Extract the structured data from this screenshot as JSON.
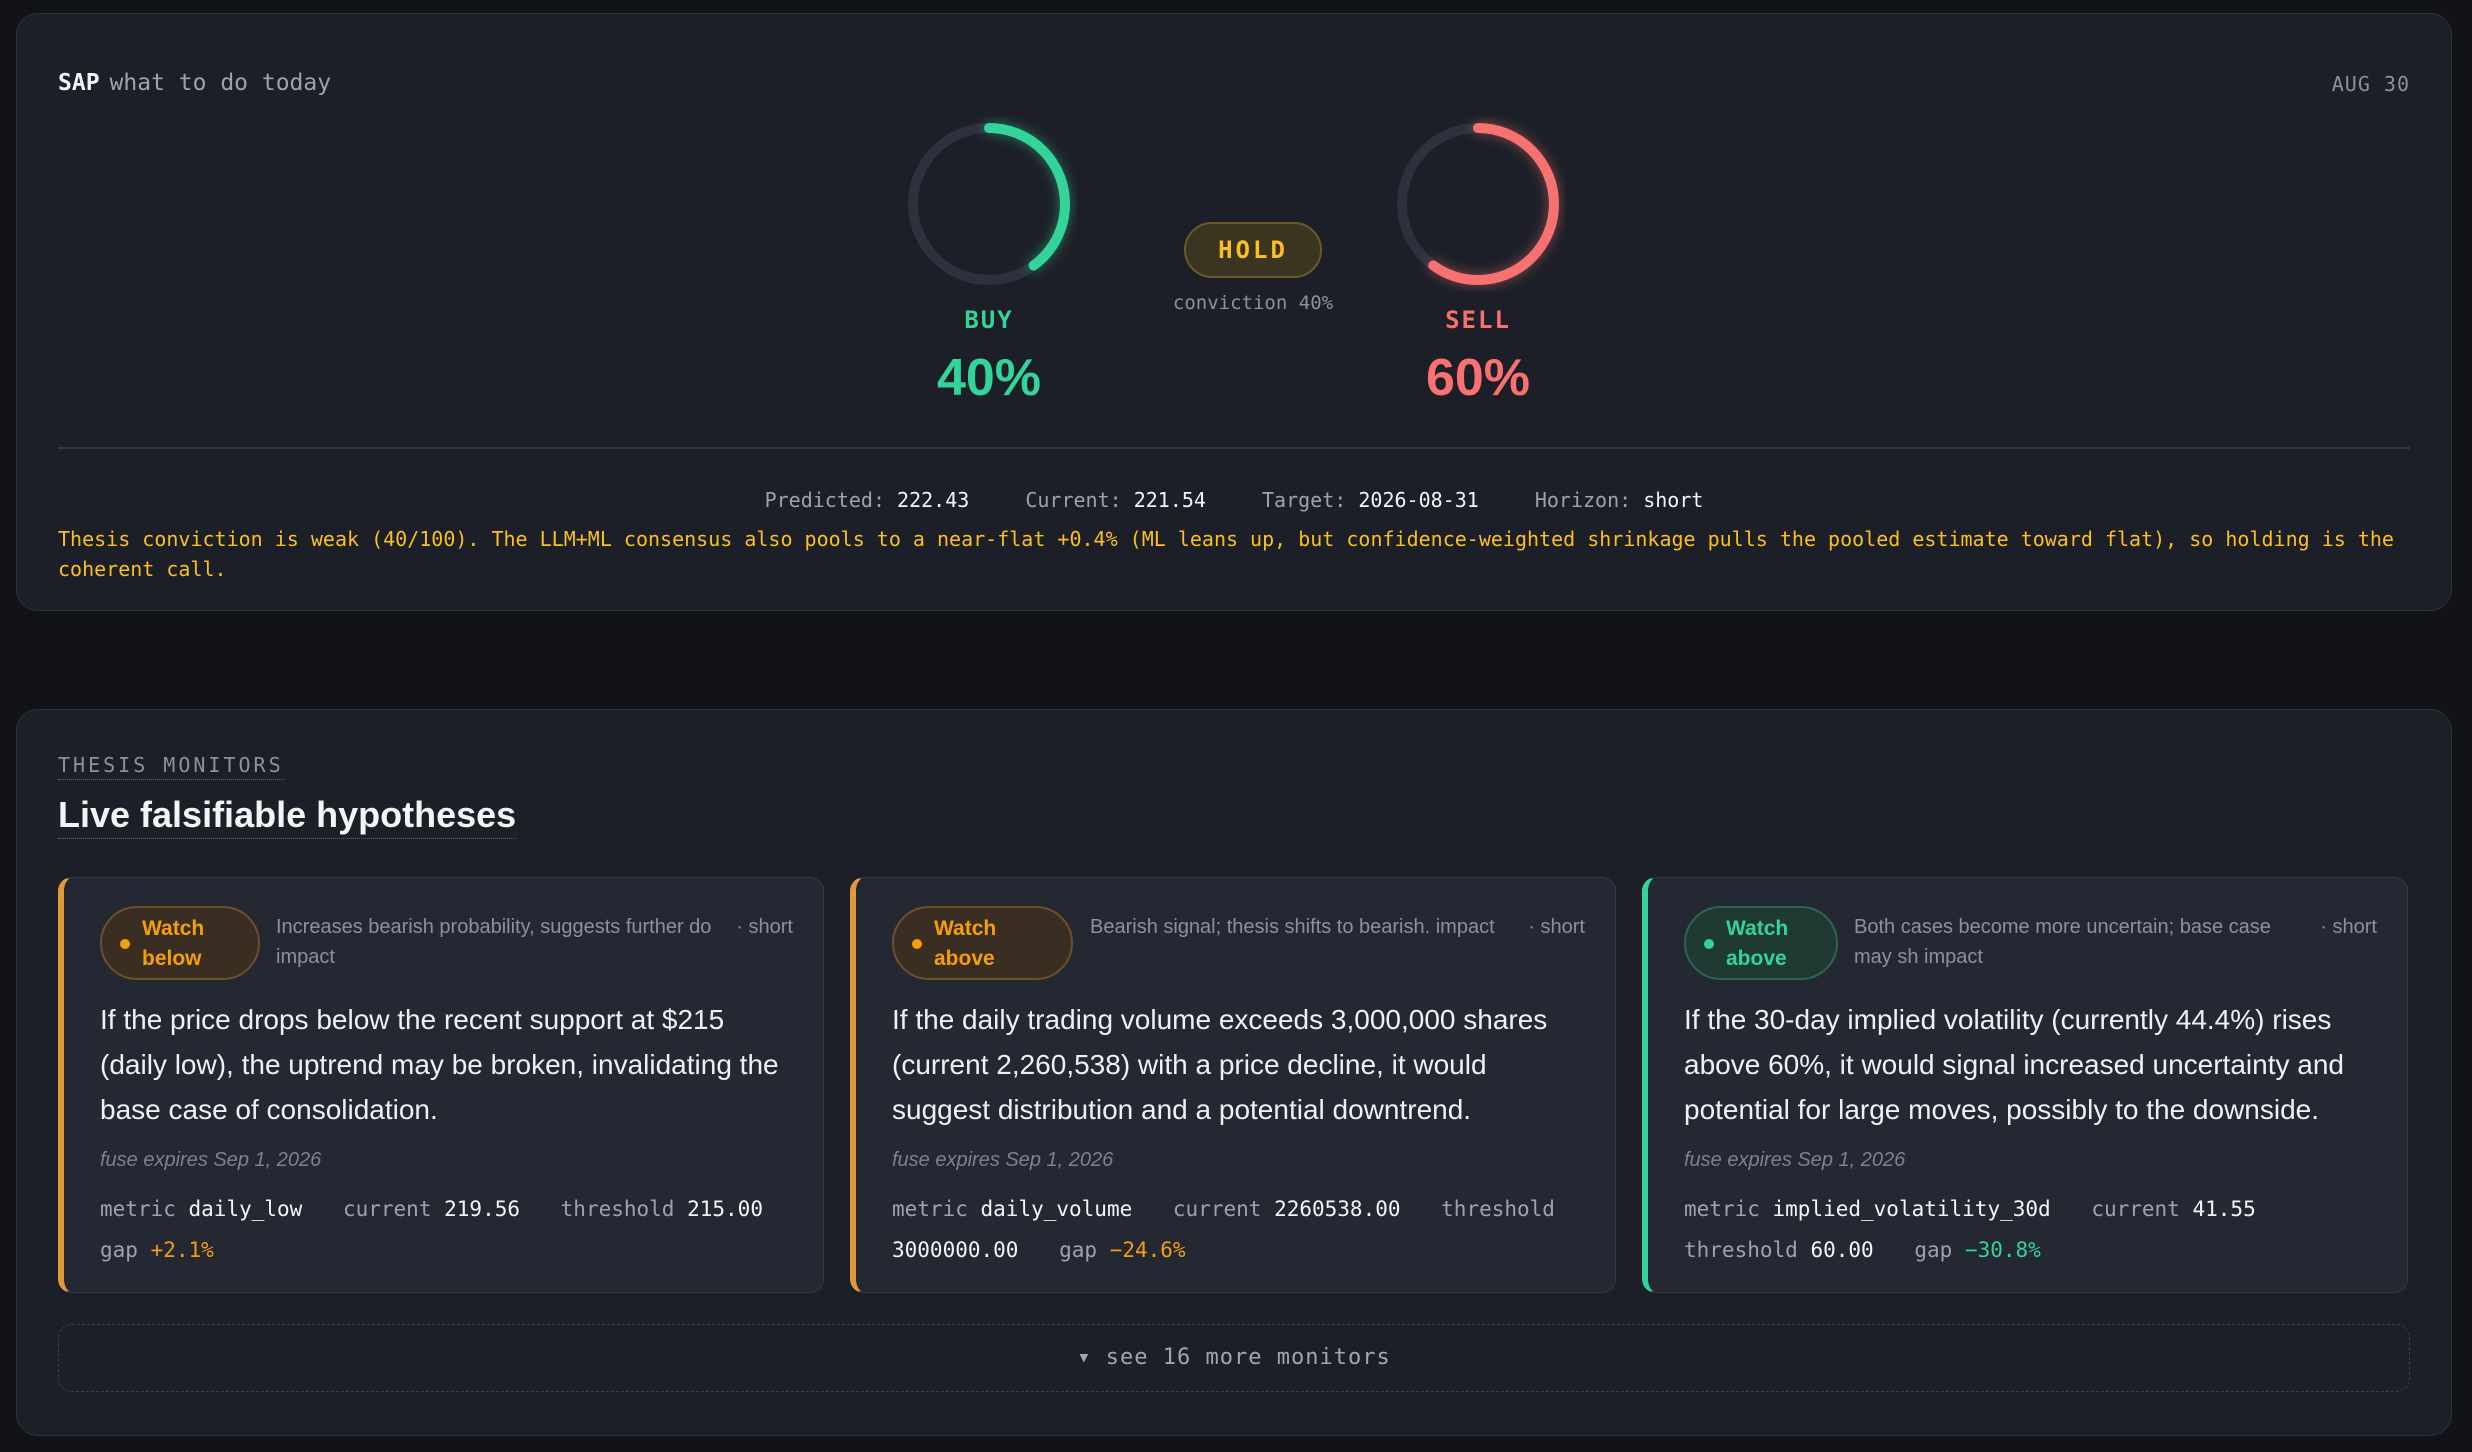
{
  "header": {
    "ticker": "SAP",
    "subtitle": "what to do today",
    "date": "AUG 30"
  },
  "gauges": {
    "buy": {
      "label": "BUY",
      "value_text": "40%",
      "fraction": 0.4,
      "color": "#34d399"
    },
    "sell": {
      "label": "SELL",
      "value_text": "60%",
      "fraction": 0.6,
      "color": "#f87171"
    }
  },
  "verdict": {
    "label": "HOLD",
    "conviction": "conviction 40%"
  },
  "stats": [
    {
      "key": "Predicted:",
      "value": "222.43"
    },
    {
      "key": "Current:",
      "value": "221.54"
    },
    {
      "key": "Target:",
      "value": "2026-08-31"
    },
    {
      "key": "Horizon:",
      "value": "short"
    }
  ],
  "thesis": "Thesis conviction is weak (40/100). The LLM+ML consensus also pools to a near-flat +0.4% (ML leans up, but confidence-weighted shrinkage pulls the pooled estimate toward flat), so holding is the coherent call.",
  "monitors": {
    "kicker": "THESIS MONITORS",
    "title": "Live falsifiable hypotheses",
    "cards": [
      {
        "badge": "Watch below",
        "description": "Increases bearish probability, suggests further do impact",
        "term": "· short",
        "body": "If the price drops below the recent support at $215 (daily low), the uptrend may be broken, invalidating the base case of consolidation.",
        "fuse": "fuse expires Sep 1, 2026",
        "metric_key": "metric",
        "metric": "daily_low",
        "current_key": "current",
        "current": "219.56",
        "threshold_key": "threshold",
        "threshold": "215.00",
        "gap_key": "gap",
        "gap": "+2.1%"
      },
      {
        "badge": "Watch above",
        "description": "Bearish signal; thesis shifts to bearish. impact",
        "term": "· short",
        "body": "If the daily trading volume exceeds 3,000,000 shares (current 2,260,538) with a price decline, it would suggest distribution and a potential downtrend.",
        "fuse": "fuse expires Sep 1, 2026",
        "metric_key": "metric",
        "metric": "daily_volume",
        "current_key": "current",
        "current": "2260538.00",
        "threshold_key": "threshold",
        "threshold": "3000000.00",
        "gap_key": "gap",
        "gap": "−24.6%"
      },
      {
        "badge": "Watch above",
        "description": "Both cases become more uncertain; base case may sh impact",
        "term": "· short",
        "body": "If the 30-day implied volatility (currently 44.4%) rises above 60%, it would signal increased uncertainty and potential for large moves, possibly to the downside.",
        "fuse": "fuse expires Sep 1, 2026",
        "metric_key": "metric",
        "metric": "implied_volatility_30d",
        "current_key": "current",
        "current": "41.55",
        "threshold_key": "threshold",
        "threshold": "60.00",
        "gap_key": "gap",
        "gap": "−30.8%"
      }
    ],
    "see_more": "▾ see 16 more monitors"
  }
}
